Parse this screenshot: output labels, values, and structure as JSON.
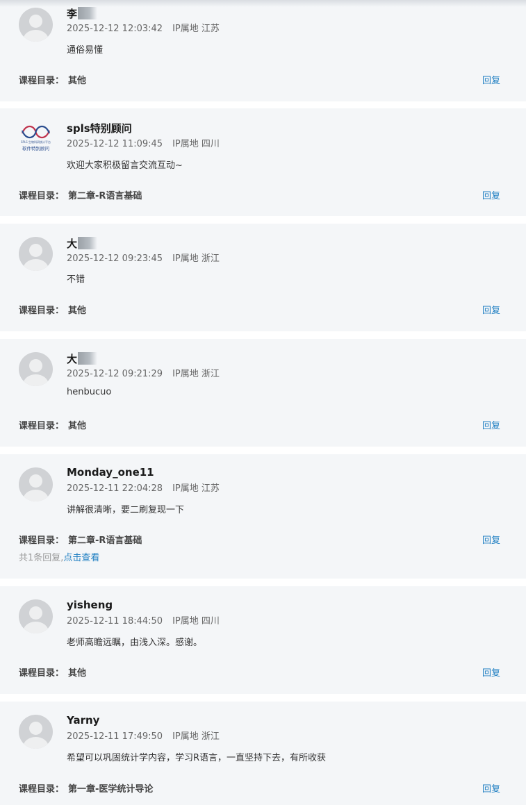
{
  "catalog_label": "课程目录：",
  "reply_label": "回复",
  "ip_prefix": "IP属地",
  "comments": [
    {
      "username": "李",
      "masked": true,
      "avatar": "default-avatar-icon",
      "datetime": "2025-12-12 12:03:42",
      "ip_location": "江苏",
      "content": "通俗易懂",
      "catalog": "其他"
    },
    {
      "username": "spls特别顾问",
      "masked": false,
      "avatar": "spls-logo-icon",
      "datetime": "2025-12-12 11:09:45",
      "ip_location": "四川",
      "content": "欢迎大家积极留言交流互动~",
      "catalog": "第二章-R语言基础"
    },
    {
      "username": "大",
      "masked": true,
      "avatar": "default-avatar-icon",
      "datetime": "2025-12-12 09:23:45",
      "ip_location": "浙江",
      "content": "不错",
      "catalog": "其他"
    },
    {
      "username": "大",
      "masked": true,
      "avatar": "default-avatar-icon",
      "datetime": "2025-12-12 09:21:29",
      "ip_location": "浙江",
      "content": "henbucuo",
      "catalog": "其他"
    },
    {
      "username": "Monday_one11",
      "masked": false,
      "avatar": "default-avatar-icon",
      "datetime": "2025-12-11 22:04:28",
      "ip_location": "江苏",
      "content": "讲解很清晰，要二刷复现一下",
      "catalog": "第二章-R语言基础",
      "reply_count_text": "共1条回复,",
      "view_link": "点击查看"
    },
    {
      "username": "yisheng",
      "masked": false,
      "avatar": "default-avatar-icon",
      "datetime": "2025-12-11 18:44:50",
      "ip_location": "四川",
      "content": "老师高瞻远瞩，由浅入深。感谢。",
      "catalog": "其他"
    },
    {
      "username": "Yarny",
      "masked": false,
      "avatar": "default-avatar-icon",
      "datetime": "2025-12-11 17:49:50",
      "ip_location": "浙江",
      "content": "希望可以巩固统计学内容，学习R语言，一直坚持下去，有所收获",
      "catalog": "第一章-医学统计导论"
    }
  ],
  "logo_text": {
    "line1": "SPLS 生物科研统计平台",
    "line2": "软件特别顾问"
  }
}
